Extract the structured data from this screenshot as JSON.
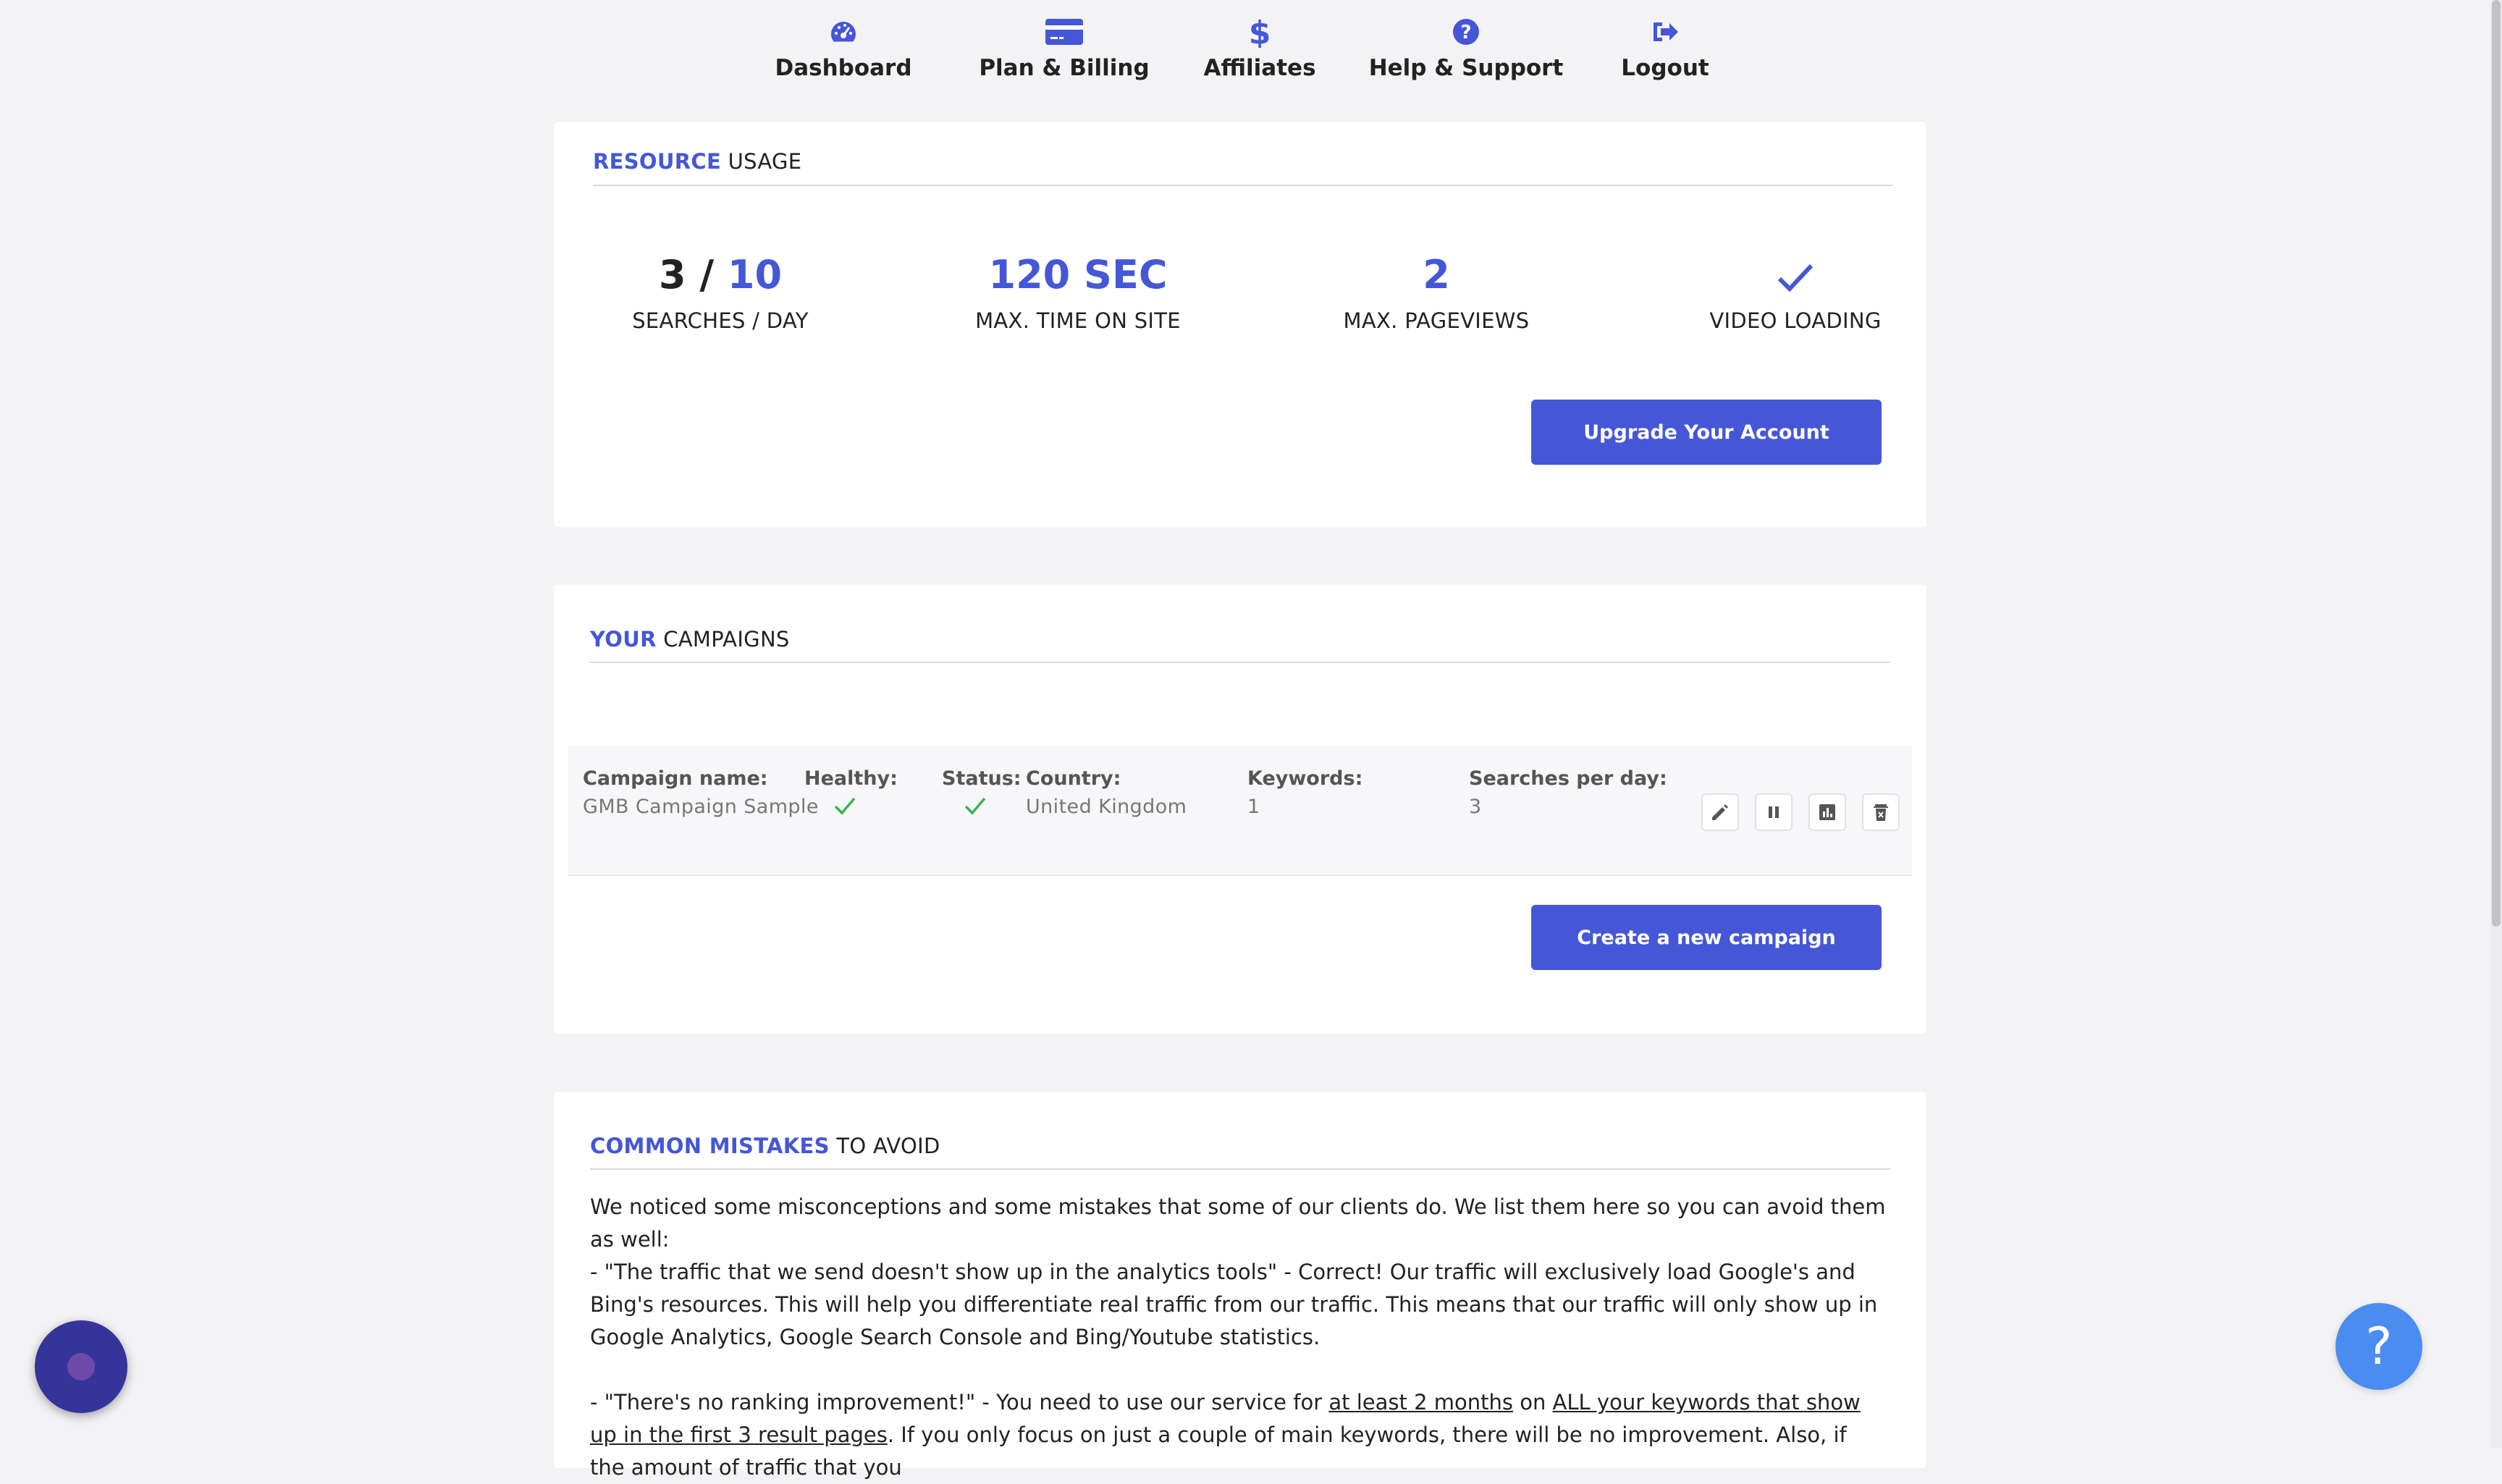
{
  "nav": [
    {
      "label": "Dashboard",
      "icon": "dashboard-gauge-icon"
    },
    {
      "label": "Plan & Billing",
      "icon": "credit-card-icon"
    },
    {
      "label": "Affiliates",
      "icon": "dollar-icon"
    },
    {
      "label": "Help & Support",
      "icon": "question-circle-icon"
    },
    {
      "label": "Logout",
      "icon": "logout-icon"
    }
  ],
  "resource": {
    "title_accent": "RESOURCE",
    "title_rest": "USAGE",
    "stats": [
      {
        "used": "3 /",
        "limit": "10",
        "caption": "SEARCHES / DAY"
      },
      {
        "value": "120 SEC",
        "caption": "MAX. TIME ON SITE"
      },
      {
        "value": "2",
        "caption": "MAX. PAGEVIEWS"
      },
      {
        "icon": "checkmark-icon",
        "caption": "VIDEO LOADING"
      }
    ],
    "upgrade_label": "Upgrade Your Account"
  },
  "campaigns": {
    "title_accent": "YOUR",
    "title_rest": "CAMPAIGNS",
    "headers": {
      "name": "Campaign name:",
      "healthy": "Healthy:",
      "status": "Status:",
      "country": "Country:",
      "keywords": "Keywords:",
      "searches": "Searches per day:"
    },
    "rows": [
      {
        "name": "GMB Campaign Sample",
        "healthy": true,
        "status": true,
        "country": "United Kingdom",
        "keywords": "1",
        "searches": "3"
      }
    ],
    "actions": [
      "edit-icon",
      "pause-icon",
      "stats-chart-icon",
      "delete-icon"
    ],
    "create_label": "Create a new campaign"
  },
  "mistakes": {
    "title_accent": "COMMON MISTAKES",
    "title_rest": "TO AVOID",
    "intro": "We noticed some misconceptions and some mistakes that some of our clients do. We list them here so you can avoid them as well:",
    "p1": "- \"The traffic that we send doesn't show up in the analytics tools\" - Correct! Our traffic will exclusively load Google's and Bing's resources. This will help you differentiate real traffic from our traffic. This means that our traffic will only show up in Google Analytics, Google Search Console and Bing/Youtube statistics.",
    "p2_a": "- \"There's no ranking improvement!\" - You need to use our service for ",
    "p2_u1": "at least 2 months",
    "p2_b": " on ",
    "p2_u2": "ALL your keywords that show up in the first 3 result pages",
    "p2_c": ". If you only focus on just a couple of main keywords, there will be no improvement. Also, if the amount of traffic that you"
  },
  "help_fab": "?",
  "colors": {
    "accent": "#4557d6",
    "healthy": "#3cb34a",
    "page_bg": "#f3f3f5"
  }
}
